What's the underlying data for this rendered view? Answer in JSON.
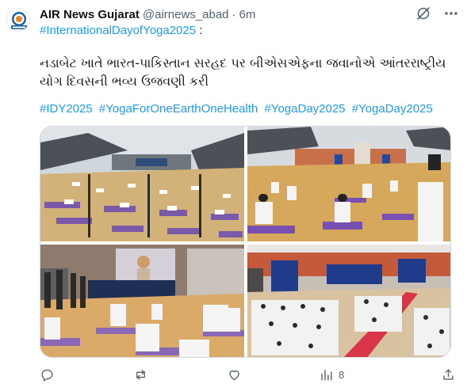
{
  "post": {
    "author_name": "AIR News Gujarat",
    "handle": "@airnews_abad",
    "separator": "·",
    "time": "6m",
    "top_hashtag": "#InternationalDayofYoga2025",
    "top_colon": ":",
    "body_text": "નડાબેટ ખાતે ભારત-પાકિસ્તાન સરહદ પર બીએસએફના જવાનોએ આંતરરાષ્ટ્રીય યોગ દિવસની ભવ્ય ઉજવણી કરી",
    "hashtags": [
      "#IDY2025",
      "#YogaForOneEarthOneHealth",
      "#YogaDay2025",
      "#YogaDay2025"
    ]
  },
  "avatar": {
    "logo_text": "AIR",
    "brand_color": "#1a5fa8"
  },
  "actions": {
    "reply_icon": "reply-icon",
    "repost_icon": "repost-icon",
    "like_icon": "heart-icon",
    "views_icon": "views-bar-icon",
    "views_count": "8",
    "share_icon": "share-icon"
  },
  "media": [
    {
      "name": "photo-stadium-overview",
      "description_icon": "image"
    },
    {
      "name": "photo-border-gate-yoga",
      "description_icon": "image"
    },
    {
      "name": "photo-meditation-screen",
      "description_icon": "image"
    },
    {
      "name": "photo-crowd-yoga-banners",
      "description_icon": "image"
    }
  ],
  "colors": {
    "link": "#1d9bf0",
    "muted": "#536471",
    "text": "#0f1419",
    "border": "#cfd9de"
  }
}
